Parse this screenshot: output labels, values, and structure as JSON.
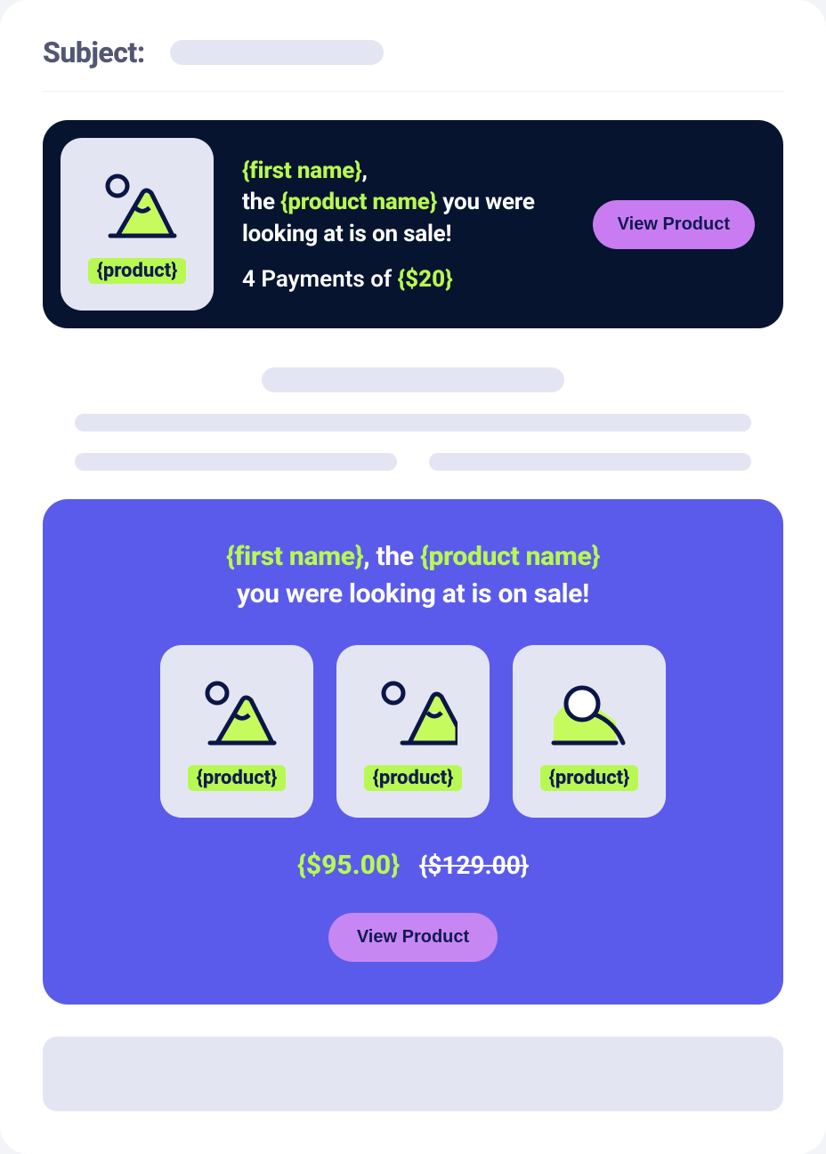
{
  "subject": {
    "label": "Subject:"
  },
  "hero_dark": {
    "product_badge": "{product}",
    "first_name_token": "{first name}",
    "product_name_token": "{product name}",
    "line_prefix_after_name": ", the ",
    "line_suffix": " you were looking at is on sale!",
    "payments_prefix": "4 Payments of ",
    "payments_amount": "{$20}",
    "cta": "View Product"
  },
  "hero_purple": {
    "first_name_token": "{first name}",
    "product_name_token": "{product name}",
    "headline_middle": ", the ",
    "headline_suffix": " you were looking at is on sale!",
    "tiles": [
      {
        "badge": "{product}"
      },
      {
        "badge": "{product}"
      },
      {
        "badge": "{product}"
      }
    ],
    "price_now": "{$95.00}",
    "price_was": "{$129.00}",
    "cta": "View Product"
  },
  "colors": {
    "navy": "#0A1647",
    "lime": "#B8F852",
    "purple": "#5B5BEB",
    "lilac": "#C97CF2",
    "grey": "#E3E6F2"
  }
}
